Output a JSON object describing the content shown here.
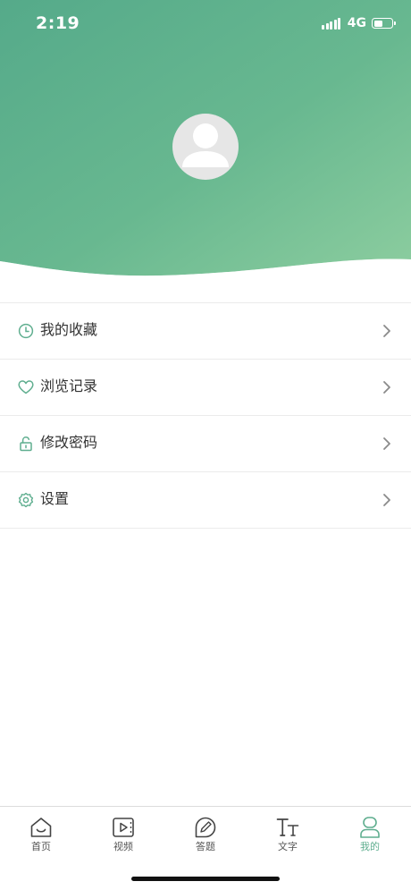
{
  "status_bar": {
    "time": "2:19",
    "network": "4G",
    "signal_icon": "signal-icon",
    "battery_icon": "battery-icon",
    "battery_level": 0.5
  },
  "profile": {
    "avatar_icon": "user-avatar-icon"
  },
  "theme": {
    "accent": "#5fae8f",
    "header_dark": "#5aae8f",
    "header_light": "#86c9a0"
  },
  "menu": {
    "items": [
      {
        "label": "我的收藏",
        "icon": "clock-icon"
      },
      {
        "label": "浏览记录",
        "icon": "heart-icon"
      },
      {
        "label": "修改密码",
        "icon": "unlock-icon"
      },
      {
        "label": "设置",
        "icon": "gear-icon"
      }
    ]
  },
  "tabbar": {
    "items": [
      {
        "label": "首页",
        "icon": "home-icon"
      },
      {
        "label": "视频",
        "icon": "video-icon"
      },
      {
        "label": "答题",
        "icon": "edit-icon"
      },
      {
        "label": "文字",
        "icon": "text-icon"
      },
      {
        "label": "我的",
        "icon": "profile-icon"
      }
    ],
    "active_index": 4
  }
}
